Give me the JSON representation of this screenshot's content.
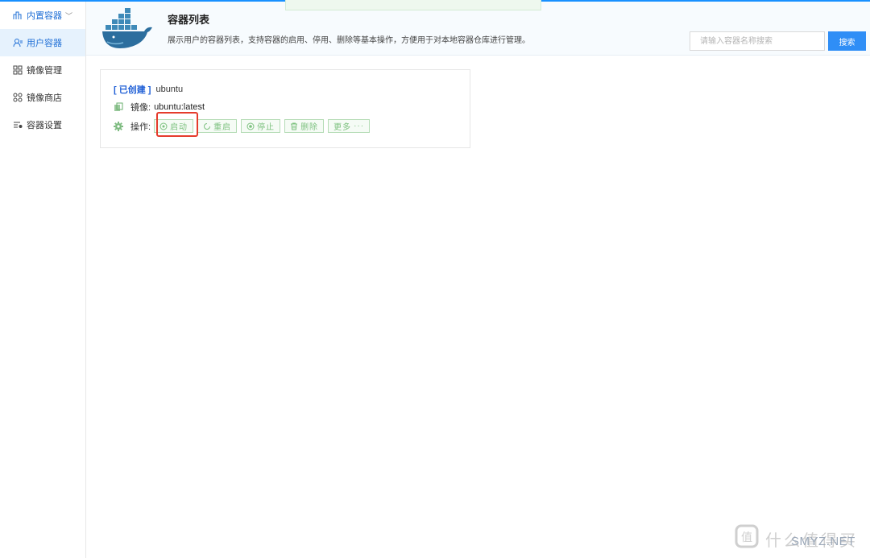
{
  "sidebar": {
    "group_label": "内置容器",
    "items": [
      {
        "label": "用户容器",
        "icon": "user-icon",
        "active": true
      },
      {
        "label": "镜像管理",
        "icon": "grid-icon",
        "active": false
      },
      {
        "label": "镜像商店",
        "icon": "apps-icon",
        "active": false
      },
      {
        "label": "容器设置",
        "icon": "settings-list-icon",
        "active": false
      }
    ]
  },
  "header": {
    "title": "容器列表",
    "description": "展示用户的容器列表，支持容器的启用、停用、删除等基本操作，方便用于对本地容器仓库进行管理。",
    "search_placeholder": "请输入容器名称搜索",
    "search_button": "搜索"
  },
  "container": {
    "status": "[ 已创建 ]",
    "name": "ubuntu",
    "image_label": "镜像:",
    "image_value": "ubuntu:latest",
    "actions_label": "操作:",
    "actions": [
      {
        "label": "启动",
        "icon": "play-circle-icon"
      },
      {
        "label": "重启",
        "icon": "refresh-icon"
      },
      {
        "label": "停止",
        "icon": "stop-circle-icon"
      },
      {
        "label": "删除",
        "icon": "trash-icon"
      },
      {
        "label": "更多",
        "icon": "more-icon"
      }
    ]
  },
  "watermark": {
    "text": "什么值得买",
    "sub": "SMYZ.NET"
  },
  "colors": {
    "primary": "#2f8ef6",
    "status": "#1f5fd6",
    "action_green": "#7dc17f",
    "highlight_red": "#e53b2c"
  }
}
